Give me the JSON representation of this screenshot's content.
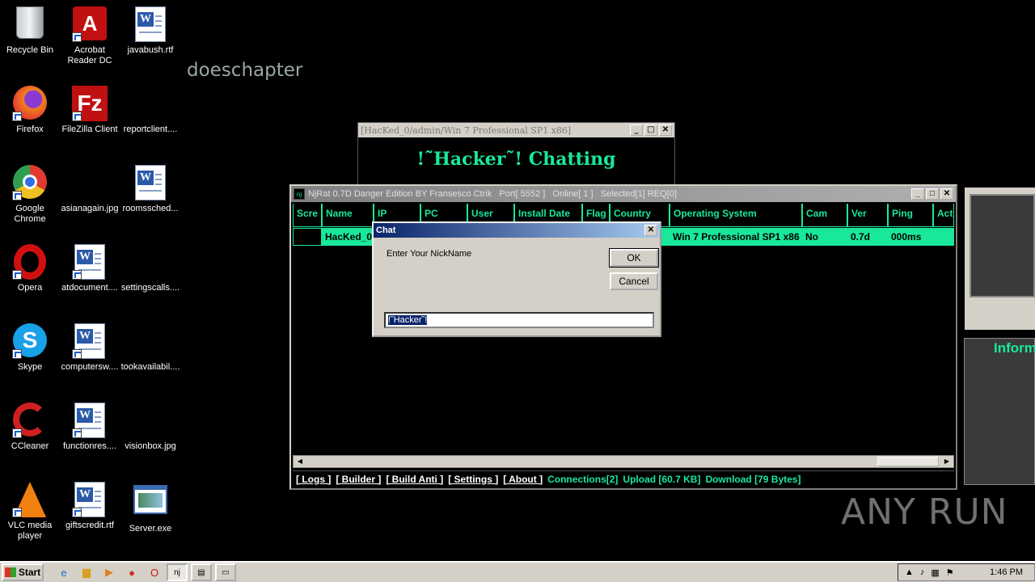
{
  "desktop": {
    "icons": [
      {
        "label": "Recycle Bin"
      },
      {
        "label": "Acrobat Reader DC"
      },
      {
        "label": "javabush.rtf"
      },
      {
        "label": "Firefox"
      },
      {
        "label": "FileZilla Client"
      },
      {
        "label": "reportclient...."
      },
      {
        "label": "Google Chrome"
      },
      {
        "label": "asianagain.jpg"
      },
      {
        "label": "roomssched..."
      },
      {
        "label": "Opera"
      },
      {
        "label": "atdocument...."
      },
      {
        "label": "settingscalls...."
      },
      {
        "label": "Skype"
      },
      {
        "label": "computersw...."
      },
      {
        "label": "tookavailabil...."
      },
      {
        "label": "CCleaner"
      },
      {
        "label": "functionres...."
      },
      {
        "label": "visionbox.jpg"
      },
      {
        "label": "VLC media player"
      },
      {
        "label": "giftscredit.rtf"
      },
      {
        "label": "Server.exe"
      }
    ],
    "background_text": "doeschapter",
    "watermark": "ANY RUN"
  },
  "back_window": {
    "title": "[HacKed_0/admin/Win 7 Professional SP1 x86]",
    "heading": "!˜Hacker˜! Chatting"
  },
  "njrat": {
    "title": "NjRat 0.7D Danger Edition BY Fransesco Ctrik   Port[ 5552 ]   Online[ 1 ]   Selected[1] REQ[0]",
    "columns": [
      "Scre",
      "Name",
      "IP",
      "PC",
      "User",
      "Install Date",
      "Flag",
      "Country",
      "Operating System",
      "Cam",
      "Ver",
      "Ping",
      "Acti Win"
    ],
    "row": [
      "",
      "HacKed_0",
      "",
      "",
      "",
      "",
      "",
      "",
      "Win 7 Professional SP1 x86",
      "No",
      "0.7d",
      "000ms",
      ""
    ],
    "links": [
      "[ Logs ]",
      "[ Builder ]",
      "[ Build Anti ]",
      "[ Settings ]",
      "[ About ]"
    ],
    "connections": "Connections[2]",
    "upload": "Upload [60.7 KB]",
    "download": "Download [79 Bytes]"
  },
  "chat_dialog": {
    "title": "Chat",
    "prompt": "Enter Your NickName",
    "ok": "OK",
    "cancel": "Cancel",
    "nickname_value": "!˜Hacker˜!"
  },
  "right_panel": {
    "text": "Inform"
  },
  "taskbar": {
    "start": "Start",
    "clock": "1:46 PM"
  },
  "colors": {
    "accent": "#19e89a",
    "title_active": "#0a246a"
  }
}
